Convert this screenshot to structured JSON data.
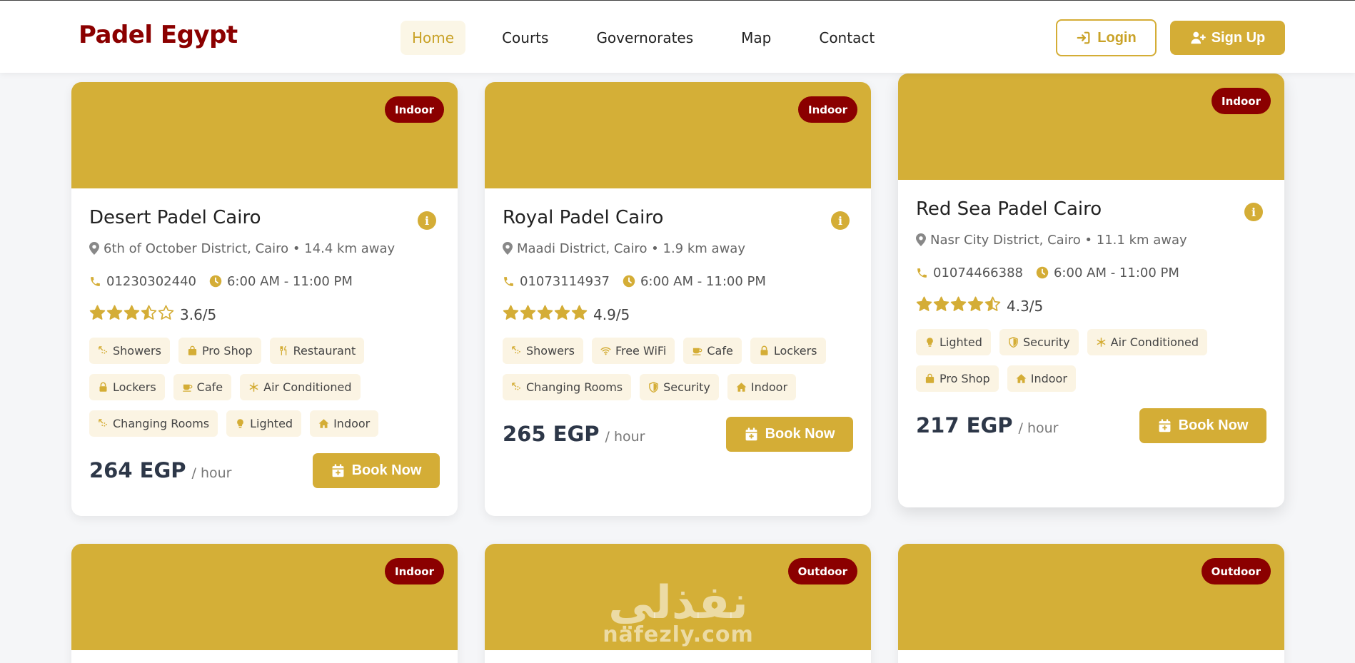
{
  "brand": "Padel Egypt",
  "nav": [
    {
      "label": "Home",
      "active": true
    },
    {
      "label": "Courts"
    },
    {
      "label": "Governorates"
    },
    {
      "label": "Map"
    },
    {
      "label": "Contact"
    }
  ],
  "auth": {
    "login": "Login",
    "signup": "Sign Up"
  },
  "colors": {
    "accent": "#d4ad36",
    "brand": "#8b0000",
    "card_image": "#d4af37"
  },
  "cards": [
    {
      "badge": "Indoor",
      "title": "Desert Padel Cairo",
      "location": "6th of October District, Cairo • 14.4 km away",
      "phone": "01230302440",
      "hours": "6:00 AM - 11:00 PM",
      "rating": 3.6,
      "rating_text": "3.6/5",
      "amenities": [
        "Showers",
        "Pro Shop",
        "Restaurant",
        "Lockers",
        "Cafe",
        "Air Conditioned",
        "Changing Rooms",
        "Lighted",
        "Indoor"
      ],
      "price": "264 EGP",
      "price_unit": "/ hour",
      "book": "Book Now"
    },
    {
      "badge": "Indoor",
      "title": "Royal Padel Cairo",
      "location": "Maadi District, Cairo • 1.9 km away",
      "phone": "01073114937",
      "hours": "6:00 AM - 11:00 PM",
      "rating": 4.9,
      "rating_text": "4.9/5",
      "amenities": [
        "Showers",
        "Free WiFi",
        "Cafe",
        "Lockers",
        "Changing Rooms",
        "Security",
        "Indoor"
      ],
      "price": "265 EGP",
      "price_unit": "/ hour",
      "book": "Book Now"
    },
    {
      "badge": "Indoor",
      "title": "Red Sea Padel Cairo",
      "location": "Nasr City District, Cairo • 11.1 km away",
      "phone": "01074466388",
      "hours": "6:00 AM - 11:00 PM",
      "rating": 4.3,
      "rating_text": "4.3/5",
      "amenities": [
        "Lighted",
        "Security",
        "Air Conditioned",
        "Pro Shop",
        "Indoor"
      ],
      "price": "217 EGP",
      "price_unit": "/ hour",
      "book": "Book Now"
    }
  ],
  "row2_badges": [
    "Indoor",
    "Outdoor",
    "Outdoor"
  ],
  "watermark": {
    "arabic": "نفذلي",
    "latin": "nafezly.com"
  }
}
